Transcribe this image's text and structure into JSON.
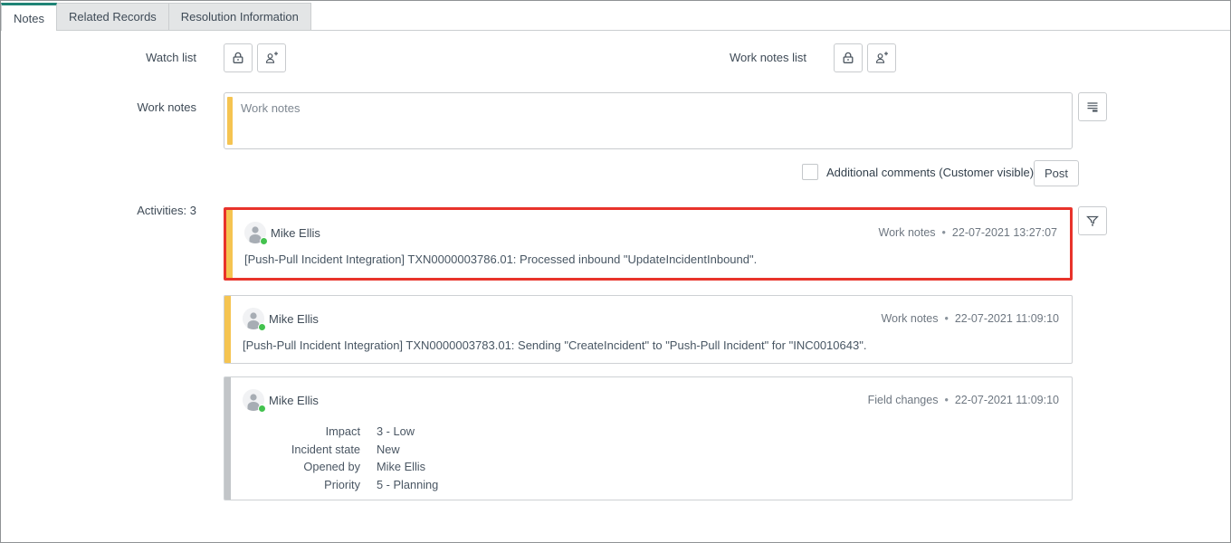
{
  "tabs": [
    {
      "label": "Notes",
      "active": true
    },
    {
      "label": "Related Records",
      "active": false
    },
    {
      "label": "Resolution Information",
      "active": false
    }
  ],
  "fields": {
    "watch_list": {
      "label": "Watch list"
    },
    "work_notes_list": {
      "label": "Work notes list"
    },
    "work_notes": {
      "label": "Work notes",
      "placeholder": "Work notes",
      "value": ""
    }
  },
  "comments": {
    "checkbox_label": "Additional comments (Customer visible)",
    "checked": false,
    "post_label": "Post"
  },
  "activities": {
    "label": "Activities: 3",
    "count": 3,
    "meta_bullet": "•",
    "entries": [
      {
        "author": "Mike Ellis",
        "type": "Work notes",
        "timestamp": "22-07-2021 13:27:07",
        "message": "[Push-Pull Incident Integration] TXN0000003786.01: Processed inbound \"UpdateIncidentInbound\".",
        "stripe": "worknotes-gold",
        "highlighted": true
      },
      {
        "author": "Mike Ellis",
        "type": "Work notes",
        "timestamp": "22-07-2021 11:09:10",
        "message": "[Push-Pull Incident Integration] TXN0000003783.01: Sending \"CreateIncident\" to \"Push-Pull Incident\" for \"INC0010643\".",
        "stripe": "worknotes-gold",
        "highlighted": false
      },
      {
        "author": "Mike Ellis",
        "type": "Field changes",
        "timestamp": "22-07-2021 11:09:10",
        "stripe": "gray",
        "highlighted": false,
        "changes": [
          {
            "field": "Impact",
            "value": "3 - Low"
          },
          {
            "field": "Incident state",
            "value": "New"
          },
          {
            "field": "Opened by",
            "value": "Mike Ellis"
          },
          {
            "field": "Priority",
            "value": "5 - Planning"
          }
        ]
      }
    ]
  },
  "icons": {
    "lock": "lock-icon",
    "add_person": "add-person-icon",
    "activity_stream": "activity-stream-icon",
    "filter": "filter-icon"
  },
  "colors": {
    "tab_accent_teal": "#1f8476",
    "worknotes_gold": "#f5c451",
    "highlight_red": "#e8332b",
    "fieldchange_gray": "#c2c5c8",
    "presence_green": "#43c24e"
  }
}
